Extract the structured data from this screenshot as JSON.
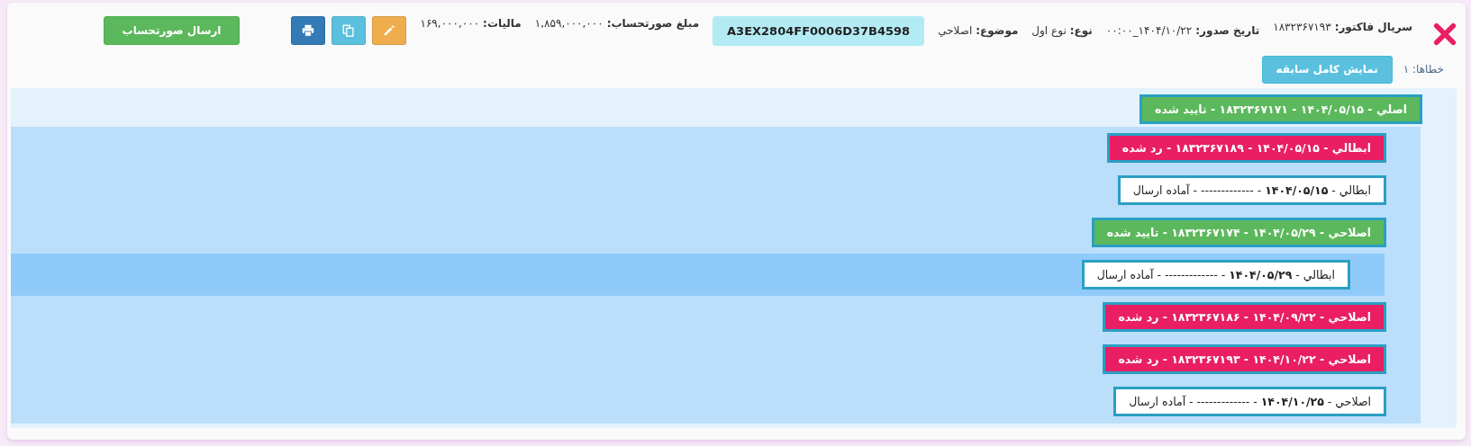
{
  "header": {
    "fields": [
      {
        "label": "سریال فاکتور:",
        "value": "۱۸۳۲۳۶۷۱۹۳"
      },
      {
        "label": "تاریخ صدور:",
        "value": "۱۴۰۴/۱۰/۲۲_۰۰:۰۰"
      },
      {
        "label": "نوع:",
        "value": "نوع اول"
      },
      {
        "label": "موضوع:",
        "value": "اصلاحي"
      }
    ],
    "tax_id": "A3EX2804FF0006D37B4598",
    "amounts": [
      {
        "label": "مبلغ صورتحساب:",
        "value": "۱,۸۵۹,۰۰۰,۰۰۰"
      },
      {
        "label": "مالیات:",
        "value": "۱۶۹,۰۰۰,۰۰۰"
      }
    ],
    "icon_buttons": [
      {
        "kind": "edit"
      },
      {
        "kind": "copy"
      },
      {
        "kind": "print"
      }
    ],
    "send_button": "ارسال صورتحساب"
  },
  "errors": "خطاها: ۱",
  "history_button": "نمایش کامل سابقه",
  "history": {
    "root": {
      "label": "اصلي - ۱۴۰۴/۰۵/۱۵ - ۱۸۳۲۳۶۷۱۷۱ - تایید شده",
      "kind": "approved",
      "children": [
        {
          "label": "ابطالي - ۱۴۰۴/۰۵/۱۵ - ۱۸۳۲۳۶۷۱۸۹ - رد شده",
          "kind": "rejected"
        },
        {
          "label": "ابطالي - **۱۴۰۴/۰۵/۱۵** - ------------- - آماده ارسال",
          "kind": "pending"
        },
        {
          "label": "اصلاحي - ۱۴۰۴/۰۵/۲۹ - ۱۸۳۲۳۶۷۱۷۴ - تایید شده",
          "kind": "approved",
          "children": [
            {
              "label": "ابطالي - **۱۴۰۴/۰۵/۲۹** - ------------- - آماده ارسال",
              "kind": "pending"
            }
          ]
        },
        {
          "label": "اصلاحي - ۱۴۰۴/۰۹/۲۲ - ۱۸۳۲۳۶۷۱۸۶ - رد شده",
          "kind": "rejected"
        },
        {
          "label": "اصلاحي - ۱۴۰۴/۱۰/۲۲ - ۱۸۳۲۳۶۷۱۹۳ - رد شده",
          "kind": "rejected"
        },
        {
          "label": "اصلاحي - **۱۴۰۴/۱۰/۲۵** - ------------- - آماده ارسال",
          "kind": "pending"
        }
      ]
    }
  }
}
